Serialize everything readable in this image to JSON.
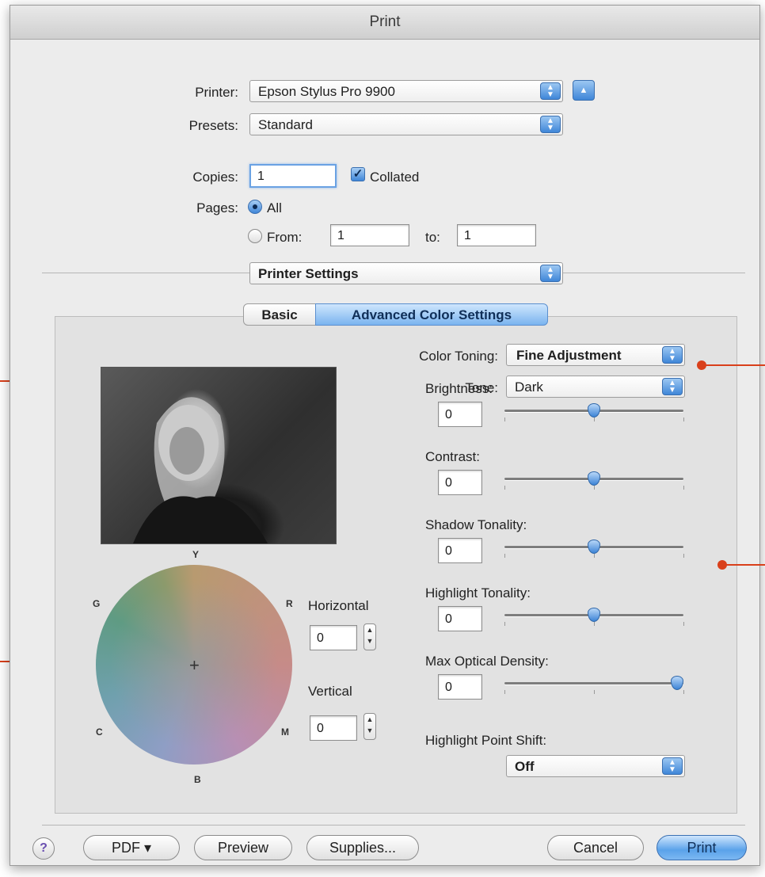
{
  "window": {
    "title": "Print"
  },
  "printer": {
    "label": "Printer:",
    "value": "Epson Stylus Pro 9900"
  },
  "presets": {
    "label": "Presets:",
    "value": "Standard"
  },
  "copies": {
    "label": "Copies:",
    "value": "1",
    "collated_label": "Collated",
    "collated_checked": true
  },
  "pages": {
    "label": "Pages:",
    "all_label": "All",
    "from_label": "From:",
    "from_value": "1",
    "to_label": "to:",
    "to_value": "1",
    "selected": "All"
  },
  "section_popup": {
    "value": "Printer Settings"
  },
  "tabs": [
    {
      "label": "Basic",
      "selected": false
    },
    {
      "label": "Advanced Color Settings",
      "selected": true
    }
  ],
  "color_toning": {
    "label": "Color Toning:",
    "value": "Fine Adjustment"
  },
  "tone": {
    "label": "Tone:",
    "value": "Dark"
  },
  "sliders": [
    {
      "label": "Brightness:",
      "value": "0",
      "level": 0.5
    },
    {
      "label": "Contrast:",
      "value": "0",
      "level": 0.5
    },
    {
      "label": "Shadow Tonality:",
      "value": "0",
      "level": 0.5
    },
    {
      "label": "Highlight Tonality:",
      "value": "0",
      "level": 0.5
    },
    {
      "label": "Max Optical Density:",
      "value": "0",
      "level": 1.0
    }
  ],
  "highlight_point_shift": {
    "label": "Highlight Point Shift:",
    "value": "Off"
  },
  "color_wheel": {
    "labels": {
      "y": "Y",
      "r": "R",
      "g": "G",
      "c": "C",
      "m": "M",
      "b": "B"
    },
    "horizontal_label": "Horizontal",
    "horizontal_value": "0",
    "vertical_label": "Vertical",
    "vertical_value": "0"
  },
  "buttons": {
    "help": "?",
    "pdf": "PDF ▾",
    "preview": "Preview",
    "supplies": "Supplies...",
    "cancel": "Cancel",
    "print": "Print"
  },
  "colors": {
    "accent": "#3f86d8",
    "callout": "#d9401b",
    "window_bg": "#ececec"
  }
}
